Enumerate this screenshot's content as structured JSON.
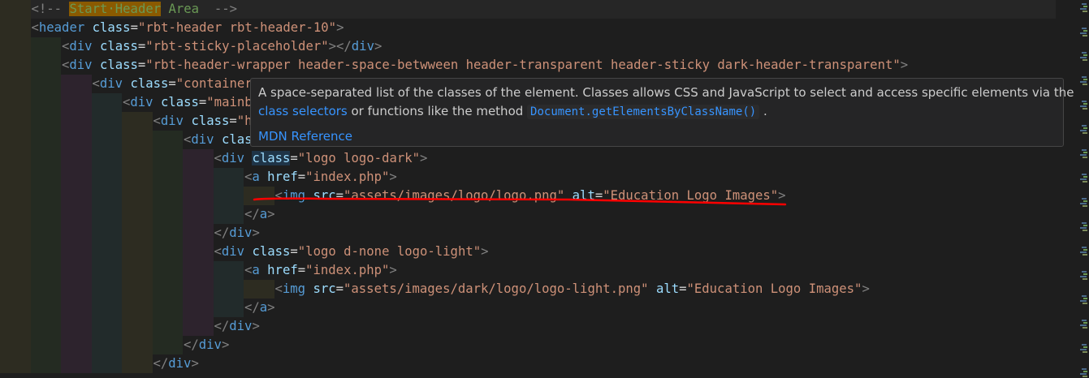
{
  "editor": {
    "lines": [
      {
        "indent": 1,
        "current": true,
        "tokens": [
          [
            "br",
            "<!-- "
          ],
          [
            "hl",
            "Start·Header"
          ],
          [
            "com",
            " Area  "
          ],
          [
            "br",
            "-->"
          ]
        ]
      },
      {
        "indent": 1,
        "tokens": [
          [
            "br",
            "<"
          ],
          [
            "tag",
            "header"
          ],
          [
            "eq",
            " "
          ],
          [
            "attr",
            "class"
          ],
          [
            "eq",
            "="
          ],
          [
            "str",
            "\"rbt-header rbt-header-10\""
          ],
          [
            "br",
            ">"
          ]
        ]
      },
      {
        "indent": 2,
        "tokens": [
          [
            "br",
            "<"
          ],
          [
            "tag",
            "div"
          ],
          [
            "eq",
            " "
          ],
          [
            "attr",
            "class"
          ],
          [
            "eq",
            "="
          ],
          [
            "str",
            "\"rbt-sticky-placeholder\""
          ],
          [
            "br",
            "></"
          ],
          [
            "tag",
            "div"
          ],
          [
            "br",
            ">"
          ]
        ]
      },
      {
        "indent": 2,
        "tokens": [
          [
            "br",
            "<"
          ],
          [
            "tag",
            "div"
          ],
          [
            "eq",
            " "
          ],
          [
            "attr",
            "class"
          ],
          [
            "eq",
            "="
          ],
          [
            "str",
            "\"rbt-header-wrapper header-space-betwween header-transparent header-sticky dark-header-transparent\""
          ],
          [
            "br",
            ">"
          ]
        ]
      },
      {
        "indent": 3,
        "tokens": [
          [
            "br",
            "<"
          ],
          [
            "tag",
            "div"
          ],
          [
            "eq",
            " "
          ],
          [
            "attr",
            "class"
          ],
          [
            "eq",
            "="
          ],
          [
            "str",
            "\"container"
          ]
        ]
      },
      {
        "indent": 4,
        "tokens": [
          [
            "br",
            "<"
          ],
          [
            "tag",
            "div"
          ],
          [
            "eq",
            " "
          ],
          [
            "attr",
            "class"
          ],
          [
            "eq",
            "="
          ],
          [
            "str",
            "\"mainb"
          ]
        ]
      },
      {
        "indent": 5,
        "tokens": [
          [
            "br",
            "<"
          ],
          [
            "tag",
            "div"
          ],
          [
            "eq",
            " "
          ],
          [
            "attr",
            "class"
          ],
          [
            "eq",
            "="
          ],
          [
            "str",
            "\"h"
          ]
        ]
      },
      {
        "indent": 6,
        "tokens": [
          [
            "br",
            "<"
          ],
          [
            "tag",
            "div"
          ],
          [
            "eq",
            " "
          ],
          [
            "attr",
            "clas"
          ]
        ]
      },
      {
        "indent": 7,
        "tokens": [
          [
            "br",
            "<"
          ],
          [
            "tag",
            "div"
          ],
          [
            "eq",
            " "
          ],
          [
            "attrhl",
            "class"
          ],
          [
            "eq",
            "="
          ],
          [
            "str",
            "\"logo logo-dark\""
          ],
          [
            "br",
            ">"
          ]
        ]
      },
      {
        "indent": 8,
        "tokens": [
          [
            "br",
            "<"
          ],
          [
            "tag",
            "a"
          ],
          [
            "eq",
            " "
          ],
          [
            "attr",
            "href"
          ],
          [
            "eq",
            "="
          ],
          [
            "str",
            "\"index.php\""
          ],
          [
            "br",
            ">"
          ]
        ]
      },
      {
        "indent": 9,
        "tokens": [
          [
            "br",
            "<"
          ],
          [
            "tag",
            "img"
          ],
          [
            "eq",
            " "
          ],
          [
            "attr",
            "src"
          ],
          [
            "eq",
            "="
          ],
          [
            "str",
            "\"assets/images/logo/logo.png\""
          ],
          [
            "eq",
            " "
          ],
          [
            "attr",
            "alt"
          ],
          [
            "eq",
            "="
          ],
          [
            "str",
            "\"Education Logo Images\""
          ],
          [
            "br",
            ">"
          ]
        ]
      },
      {
        "indent": 8,
        "tokens": [
          [
            "br",
            "</"
          ],
          [
            "tag",
            "a"
          ],
          [
            "br",
            ">"
          ]
        ]
      },
      {
        "indent": 7,
        "tokens": [
          [
            "br",
            "</"
          ],
          [
            "tag",
            "div"
          ],
          [
            "br",
            ">"
          ]
        ]
      },
      {
        "indent": 7,
        "tokens": [
          [
            "br",
            "<"
          ],
          [
            "tag",
            "div"
          ],
          [
            "eq",
            " "
          ],
          [
            "attr",
            "class"
          ],
          [
            "eq",
            "="
          ],
          [
            "str",
            "\"logo d-none logo-light\""
          ],
          [
            "br",
            ">"
          ]
        ]
      },
      {
        "indent": 8,
        "tokens": [
          [
            "br",
            "<"
          ],
          [
            "tag",
            "a"
          ],
          [
            "eq",
            " "
          ],
          [
            "attr",
            "href"
          ],
          [
            "eq",
            "="
          ],
          [
            "str",
            "\"index.php\""
          ],
          [
            "br",
            ">"
          ]
        ]
      },
      {
        "indent": 9,
        "tokens": [
          [
            "br",
            "<"
          ],
          [
            "tag",
            "img"
          ],
          [
            "eq",
            " "
          ],
          [
            "attr",
            "src"
          ],
          [
            "eq",
            "="
          ],
          [
            "str",
            "\"assets/images/dark/logo/logo-light.png\""
          ],
          [
            "eq",
            " "
          ],
          [
            "attr",
            "alt"
          ],
          [
            "eq",
            "="
          ],
          [
            "str",
            "\"Education Logo Images\""
          ],
          [
            "br",
            ">"
          ]
        ]
      },
      {
        "indent": 8,
        "tokens": [
          [
            "br",
            "</"
          ],
          [
            "tag",
            "a"
          ],
          [
            "br",
            ">"
          ]
        ]
      },
      {
        "indent": 7,
        "tokens": [
          [
            "br",
            "</"
          ],
          [
            "tag",
            "div"
          ],
          [
            "br",
            ">"
          ]
        ]
      },
      {
        "indent": 6,
        "tokens": [
          [
            "br",
            "</"
          ],
          [
            "tag",
            "div"
          ],
          [
            "br",
            ">"
          ]
        ]
      },
      {
        "indent": 5,
        "tokens": [
          [
            "br",
            "</"
          ],
          [
            "tag",
            "div"
          ],
          [
            "br",
            ">"
          ]
        ]
      }
    ]
  },
  "tooltip": {
    "line1": "A space-separated list of the classes of the element. Classes allows CSS and JavaScript to select and access specific elements via the",
    "link1": "class selectors",
    "mid": " or functions like the method ",
    "code": "Document.getElementsByClassName()",
    "end": " .",
    "mdn": "MDN Reference"
  },
  "colors": {
    "annotation_underline": "#ff0000",
    "background": "#1e1e1e"
  }
}
